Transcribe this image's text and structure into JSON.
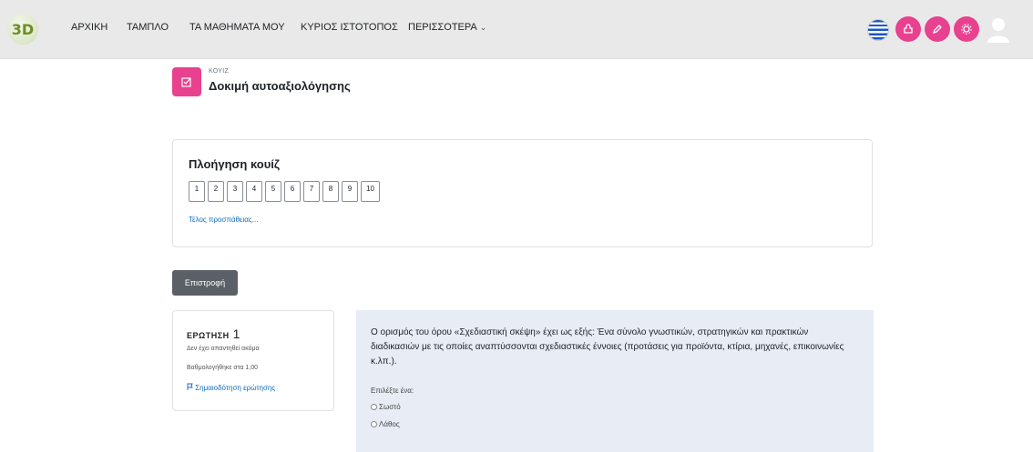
{
  "brand": {
    "logo_text": "3D"
  },
  "nav": {
    "items": [
      "ΑΡΧΙΚΗ",
      "ΤΑΜΠΛΟ",
      "ΤΑ ΜΑΘΗΜΑΤΑ ΜΟΥ",
      "ΚΥΡΙΟΣ ΙΣΤΟΤΟΠΟΣ",
      "ΠΕΡΙΣΣΟΤΕΡΑ"
    ],
    "more_chevron": "⌄"
  },
  "header": {
    "kicker": "ΚΟΥΙΖ",
    "title": "Δοκιμή αυτοαξιολόγησης"
  },
  "quiz_nav": {
    "title": "Πλοήγηση κουίζ",
    "buttons": [
      "1",
      "2",
      "3",
      "4",
      "5",
      "6",
      "7",
      "8",
      "9",
      "10"
    ],
    "finish_link": "Τέλος προσπάθειας..."
  },
  "back_button": "Επιστροφή",
  "question_info": {
    "label": "ΕΡΩΤΗΣΗ",
    "number": "1",
    "state": "Δεν έχει απαντηθεί ακόμα",
    "grade": "Βαθμολογήθηκε στα 1,00",
    "flag_link": "Σημαιοδότηση ερώτησης"
  },
  "question": {
    "text": "Ο ορισμός του όρου «Σχεδιαστική σκέψη» έχει ως εξής: Ένα σύνολο γνωστικών, στρατηγικών και πρακτικών διαδικασιών με τις οποίες αναπτύσσονται σχεδιαστικές έννοιες (προτάσεις για προϊόντα, κτίρια, μηχανές, επικοινωνίες κ.λπ.).",
    "prompt": "Επιλέξτε ένα:",
    "options": [
      "Σωστό",
      "Λάθος"
    ]
  },
  "colors": {
    "accent": "#e8418f",
    "link": "#0f6cbf",
    "button": "#5a6066",
    "content_bg": "#e7ecf5"
  },
  "icons": [
    "flag-greece-icon",
    "plugin-icon",
    "edit-icon",
    "settings-icon",
    "user-avatar-icon",
    "quiz-icon",
    "flag-icon"
  ]
}
